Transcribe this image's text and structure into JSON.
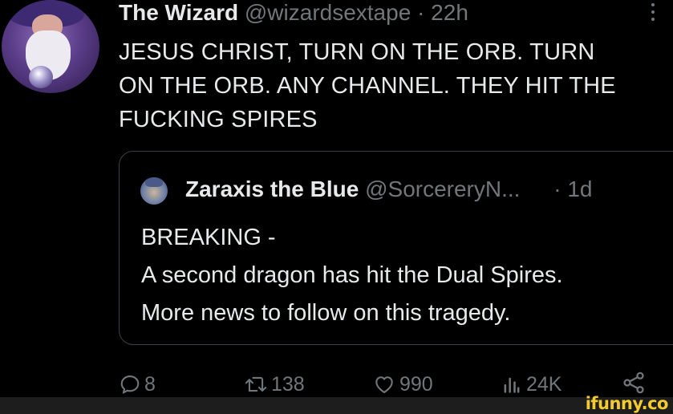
{
  "tweet": {
    "author_name": "The Wizard",
    "author_handle": "@wizardsextape",
    "separator": "·",
    "time": "22h",
    "text_lines": [
      "JESUS CHRIST, TURN ON THE ORB. TURN",
      "ON THE ORB. ANY CHANNEL. THEY HIT THE",
      "FUCKING SPIRES"
    ]
  },
  "quote": {
    "author_name": "Zaraxis the Blue",
    "author_handle": "@SorcereryN...",
    "separator": "·",
    "time": "1d",
    "text_lines": [
      "BREAKING -",
      "A second dragon has hit the Dual Spires.",
      "More news to follow on this tragedy."
    ]
  },
  "actions": {
    "replies": "8",
    "retweets": "138",
    "likes": "990",
    "views": "24K"
  },
  "icons": {
    "reply": "reply-icon",
    "retweet": "retweet-icon",
    "like": "heart-icon",
    "views": "views-icon",
    "share": "share-icon",
    "more": "more-icon"
  },
  "colors": {
    "background": "#000000",
    "text": "#e7e9ea",
    "muted": "#71767b",
    "border": "#3b4045",
    "watermark": "#f3cb2e"
  },
  "watermark": "ifunny.co"
}
